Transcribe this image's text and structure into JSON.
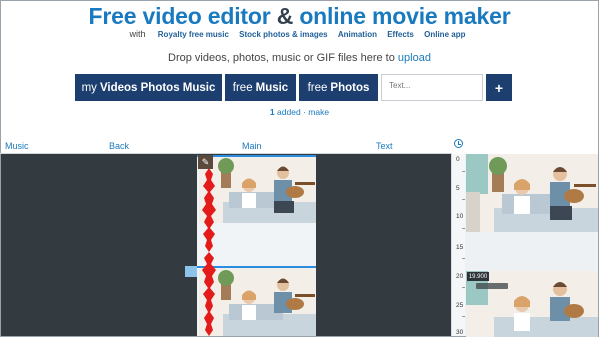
{
  "header": {
    "title_free": "Free",
    "title_mid": "video editor",
    "title_amp": "&",
    "title_end": "online movie maker",
    "with_label": "with",
    "nav_links": [
      "Royalty free music",
      "Stock photos & images",
      "Animation",
      "Effects",
      "Online app"
    ],
    "drop_text": "Drop videos, photos, music or GIF files here to ",
    "upload_link": "upload"
  },
  "buttons": {
    "my_prefix": "my",
    "my_label": "Videos Photos Music",
    "free_music_prefix": "free",
    "free_music_label": "Music",
    "free_photos_prefix": "free",
    "free_photos_label": "Photos",
    "text_placeholder": "Text...",
    "add_label": "+"
  },
  "status": {
    "count": "1",
    "added_text": "added",
    "separator": "·",
    "make_link": "make"
  },
  "timeline": {
    "tracks": [
      "Music",
      "Back",
      "Main",
      "Text"
    ],
    "ruler_marks": [
      "0",
      "5",
      "10",
      "15",
      "20",
      "25",
      "30"
    ],
    "current_time": "19.900",
    "colors": {
      "accent": "#1a7abf",
      "button_bg": "#1c3f70",
      "timeline_bg": "#333a40",
      "waveform": "#e41b1b",
      "selection_bar": "#2b8de0"
    },
    "icons": {
      "clock": "clock-icon",
      "pin": "pin-icon"
    }
  }
}
